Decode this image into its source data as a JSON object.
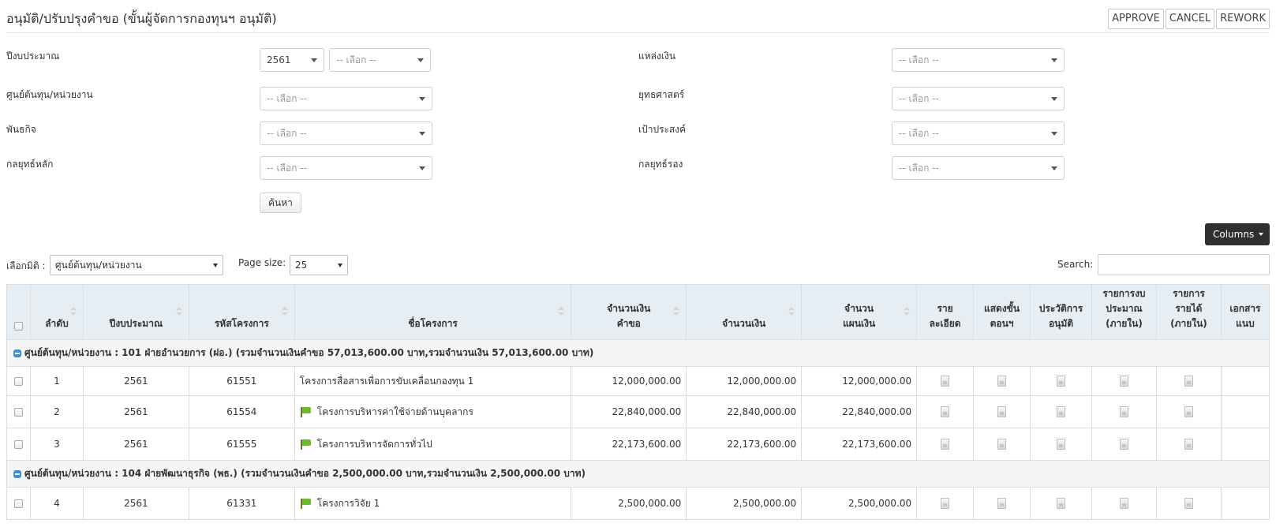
{
  "page_title": "อนุมัติ/ปรับปรุงคำขอ (ขั้นผู้จัดการกองทุนฯ อนุมัติ)",
  "actions": {
    "approve": "APPROVE",
    "cancel": "CANCEL",
    "rework": "REWORK"
  },
  "filters": {
    "budget_year": {
      "label": "ปีงบประมาณ",
      "value": "2561",
      "sub_placeholder": "-- เลือก --"
    },
    "funding_source": {
      "label": "แหล่งเงิน",
      "placeholder": "-- เลือก --"
    },
    "cost_center": {
      "label": "ศูนย์ต้นทุน/หน่วยงาน",
      "placeholder": "-- เลือก --"
    },
    "strategy": {
      "label": "ยุทธศาสตร์",
      "placeholder": "-- เลือก --"
    },
    "mission": {
      "label": "พันธกิจ",
      "placeholder": "-- เลือก --"
    },
    "goal": {
      "label": "เป้าประสงค์",
      "placeholder": "-- เลือก --"
    },
    "main_strategy": {
      "label": "กลยุทธ์หลัก",
      "placeholder": "-- เลือก --"
    },
    "sub_strategy": {
      "label": "กลยุทธ์รอง",
      "placeholder": "-- เลือก --"
    },
    "search_button": "ค้นหา"
  },
  "toolbar": {
    "columns_button": "Columns",
    "dimension_label": "เลือกมิติ :",
    "dimension_value": "ศูนย์ต้นทุน/หน่วยงาน",
    "page_size_label": "Page size:",
    "page_size_value": "25",
    "search_label": "Search:"
  },
  "table": {
    "headers": {
      "index": "ลำดับ",
      "budget_year": "ปีงบประมาณ",
      "project_code": "รหัสโครงการ",
      "project_name": "ชื่อโครงการ",
      "requested_amount_1": "จำนวนเงิน",
      "requested_amount_2": "คำขอ",
      "amount": "จำนวนเงิน",
      "plan_amount_1": "จำนวน",
      "plan_amount_2": "แผนเงิน",
      "detail_1": "ราย",
      "detail_2": "ละเอียด",
      "steps_1": "แสดงขั้น",
      "steps_2": "ตอนฯ",
      "history_1": "ประวัติการ",
      "history_2": "อนุมัติ",
      "budget_items_1": "รายการงบ",
      "budget_items_2": "ประมาณ",
      "budget_items_3": "(ภายใน)",
      "income_items_1": "รายการ",
      "income_items_2": "รายได้",
      "income_items_3": "(ภายใน)",
      "attachments_1": "เอกสาร",
      "attachments_2": "แนบ"
    },
    "groups": [
      {
        "label": "ศูนย์ต้นทุน/หน่วยงาน : 101 ฝ่ายอำนวยการ (ฝอ.) (รวมจำนวนเงินคำขอ 57,013,600.00 บาท,รวมจำนวนเงิน 57,013,600.00 บาท)",
        "rows": [
          {
            "index": "1",
            "year": "2561",
            "code": "61551",
            "name": "โครงการสื่อสารเพื่อการขับเคลื่อนกองทุน 1",
            "requested": "12,000,000.00",
            "amount": "12,000,000.00",
            "plan": "12,000,000.00"
          },
          {
            "index": "2",
            "year": "2561",
            "code": "61554",
            "name": "โครงการบริหารค่าใช้จ่ายด้านบุคลากร",
            "requested": "22,840,000.00",
            "amount": "22,840,000.00",
            "plan": "22,840,000.00"
          },
          {
            "index": "3",
            "year": "2561",
            "code": "61555",
            "name": "โครงการบริหารจัดการทั่วไป",
            "requested": "22,173,600.00",
            "amount": "22,173,600.00",
            "plan": "22,173,600.00"
          }
        ]
      },
      {
        "label": "ศูนย์ต้นทุน/หน่วยงาน : 104 ฝ่ายพัฒนาธุรกิจ (พธ.) (รวมจำนวนเงินคำขอ 2,500,000.00 บาท,รวมจำนวนเงิน 2,500,000.00 บาท)",
        "rows": [
          {
            "index": "4",
            "year": "2561",
            "code": "61331",
            "name": "โครงการวิจัย 1",
            "requested": "2,500,000.00",
            "amount": "2,500,000.00",
            "plan": "2,500,000.00"
          }
        ]
      }
    ]
  }
}
